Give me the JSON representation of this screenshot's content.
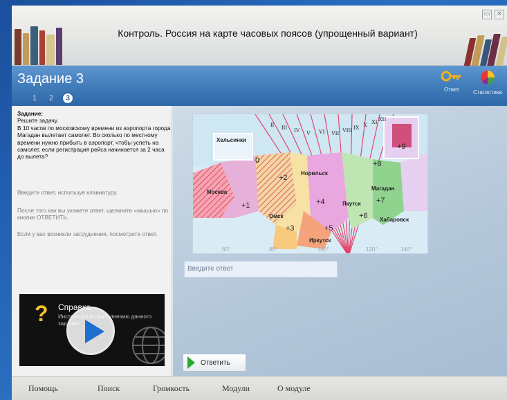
{
  "window": {
    "title": "Контроль. Россия на карте часовых поясов (упрощенный вариант)",
    "restore_icon": "restore-icon",
    "close_icon": "close-icon"
  },
  "task_header": {
    "title": "Задание 3",
    "steps": [
      "1",
      "2",
      "3"
    ],
    "active_step": "3",
    "tools": [
      {
        "label": "Ответ",
        "icon": "key-icon"
      },
      {
        "label": "Статистика",
        "icon": "pie-chart-icon"
      }
    ]
  },
  "task": {
    "heading": "Задание:",
    "line1": "Решите задачу.",
    "body": "В 10 часов по московскому времени из аэропорта города Магадан вылетает самолет. Во сколько по местному времени нужно прибыть в аэропорт, чтобы успеть на самолет, если регистрация рейса начинается за 2 часа до вылета?",
    "hint1": "Введите ответ, используя клавиатуру.",
    "hint2": "После того как вы укажете ответ, щелкните «мышью» по кнопке ОТВЕТИТЬ.",
    "hint3": "Если у вас возникли затруднения, посмотрите ответ."
  },
  "help": {
    "title": "Справка",
    "description": "Инструкция по выполнению данного задания"
  },
  "map": {
    "cities": [
      "Хельсинки",
      "Норильск",
      "Якутск",
      "Омск",
      "Иркутск",
      "Магадан",
      "Хабаровск",
      "Москва"
    ],
    "offsets": [
      "+2",
      "+3",
      "+4",
      "+5",
      "+6",
      "+7",
      "+8",
      "+9",
      "0",
      "+1"
    ],
    "roman": [
      "II",
      "III",
      "IV",
      "V",
      "VI",
      "VII",
      "VIII",
      "IX",
      "X",
      "XI",
      "XII"
    ],
    "degrees": [
      "60°",
      "80°",
      "100°",
      "120°",
      "140°"
    ]
  },
  "answer": {
    "placeholder": "Введите ответ",
    "submit_label": "Ответить"
  },
  "footer": {
    "items": [
      "Помощь",
      "Поиск",
      "Громкость",
      "Модули",
      "О модуле"
    ]
  },
  "colors": {
    "band_blue": "#3f7ab9",
    "submit_arrow": "#2aa832",
    "help_question": "#f3c22b"
  }
}
